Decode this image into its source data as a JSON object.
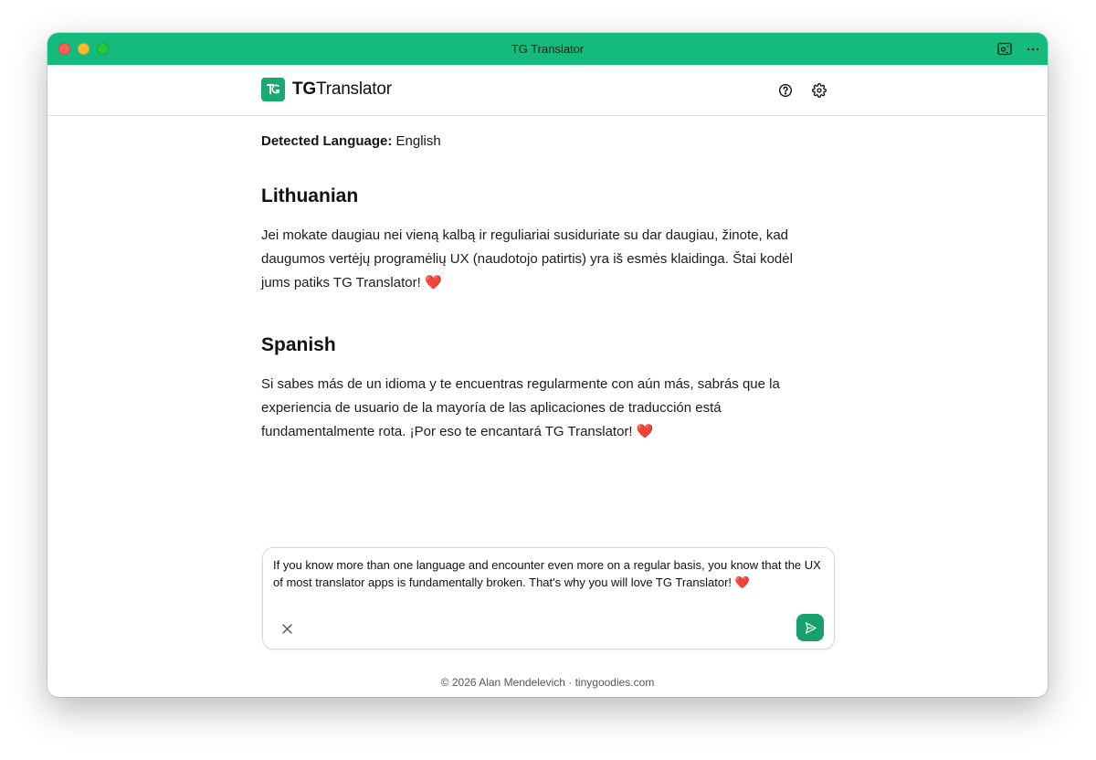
{
  "window": {
    "title": "TG Translator"
  },
  "header": {
    "logo_bold": "TG",
    "logo_rest": "Translator",
    "icons": [
      "help-circle-icon",
      "gear-icon"
    ]
  },
  "detected": {
    "label": "Detected Language:",
    "value": "English"
  },
  "translations": [
    {
      "language": "Lithuanian",
      "text": "Jei mokate daugiau nei vieną kalbą ir reguliariai susiduriate su dar daugiau, žinote, kad daugumos vertėjų programėlių UX (naudotojo patirtis) yra iš esmės klaidinga. Štai kodėl jums patiks TG Translator! ❤️"
    },
    {
      "language": "Spanish",
      "text": "Si sabes más de un idioma y te encuentras regularmente con aún más, sabrás que la experiencia de usuario de la mayoría de las aplicaciones de traducción está fundamentalmente rota. ¡Por eso te encantará TG Translator! ❤️"
    }
  ],
  "input": {
    "value": "If you know more than one language and encounter even more on a regular basis, you know that the UX of most translator apps is fundamentally broken. That's why you will love TG Translator! ❤️"
  },
  "footer": {
    "text": "© 2026 Alan Mendelevich · tinygoodies.com"
  },
  "colors": {
    "titlebar": "#14bb7c",
    "accent": "#15a16c"
  }
}
